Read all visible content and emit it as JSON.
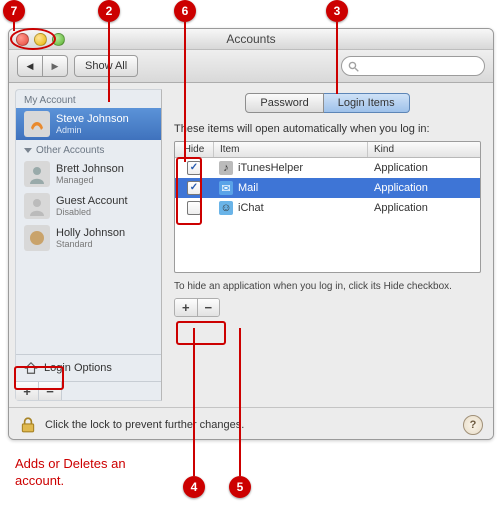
{
  "window": {
    "title": "Accounts"
  },
  "toolbar": {
    "show_all": "Show All"
  },
  "sidebar": {
    "sections": [
      {
        "label": "My Account"
      },
      {
        "label": "Other Accounts"
      }
    ],
    "accounts": [
      {
        "name": "Steve Johnson",
        "role": "Admin",
        "selected": true
      },
      {
        "name": "Brett Johnson",
        "role": "Managed"
      },
      {
        "name": "Guest Account",
        "role": "Disabled"
      },
      {
        "name": "Holly Johnson",
        "role": "Standard"
      }
    ],
    "login_options": "Login Options"
  },
  "pane": {
    "tabs": [
      "Password",
      "Login Items"
    ],
    "active_tab": 1,
    "instruction": "These items will open automatically when you log in:",
    "columns": [
      "Hide",
      "Item",
      "Kind"
    ],
    "items": [
      {
        "hide": true,
        "name": "iTunesHelper",
        "kind": "Application"
      },
      {
        "hide": true,
        "name": "Mail",
        "kind": "Application",
        "selected": true
      },
      {
        "hide": false,
        "name": "iChat",
        "kind": "Application"
      }
    ],
    "hint": "To hide an application when you log in, click its Hide checkbox."
  },
  "footer": {
    "lock_text": "Click the lock to prevent further changes."
  },
  "captions": {
    "add_delete": "Adds or Deletes an account."
  },
  "callouts": [
    {
      "num": "7"
    },
    {
      "num": "2"
    },
    {
      "num": "3"
    },
    {
      "num": "4"
    },
    {
      "num": "5"
    },
    {
      "num": "6"
    },
    {
      "num": "7"
    }
  ]
}
